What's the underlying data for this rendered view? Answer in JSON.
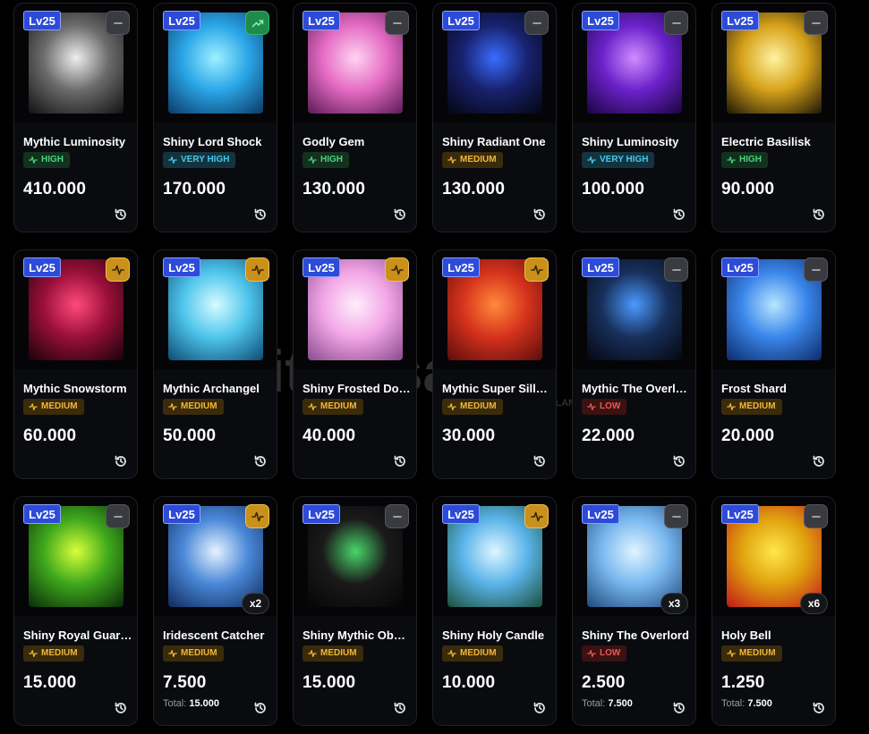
{
  "level_label": "Lv25",
  "total_label": "Total:",
  "watermark": "itemsatis",
  "watermark_sub": "HESAP / SKIN / İLAN",
  "cards": [
    {
      "name": "Mythic Luminosity",
      "demand": "HIGH",
      "demand_style": "high",
      "price": "410.000",
      "trend": "flat",
      "art": [
        "#eeeeee",
        "#6b6b6b",
        "#111"
      ]
    },
    {
      "name": "Shiny Lord Shock",
      "demand": "VERY HIGH",
      "demand_style": "vhigh",
      "price": "170.000",
      "trend": "up",
      "art": [
        "#9ff0ff",
        "#2aa6e8",
        "#0b3a66"
      ]
    },
    {
      "name": "Godly Gem",
      "demand": "HIGH",
      "demand_style": "high",
      "price": "130.000",
      "trend": "flat",
      "art": [
        "#ffd3f2",
        "#e56cc4",
        "#5a1a55"
      ]
    },
    {
      "name": "Shiny Radiant One",
      "demand": "MEDIUM",
      "demand_style": "med",
      "price": "130.000",
      "trend": "flat",
      "art": [
        "#3a6cff",
        "#18226e",
        "#04050f"
      ]
    },
    {
      "name": "Shiny Luminosity",
      "demand": "VERY HIGH",
      "demand_style": "vhigh",
      "price": "100.000",
      "trend": "flat",
      "art": [
        "#d08cff",
        "#6a22c9",
        "#1a0440"
      ]
    },
    {
      "name": "Electric Basilisk",
      "demand": "HIGH",
      "demand_style": "high",
      "price": "90.000",
      "trend": "flat",
      "art": [
        "#fff3a0",
        "#d6a21a",
        "#1e1606"
      ]
    },
    {
      "name": "Mythic Snowstorm",
      "demand": "MEDIUM",
      "demand_style": "med",
      "price": "60.000",
      "trend": "warn",
      "art": [
        "#ff4a7a",
        "#9a0f3a",
        "#1a0208"
      ]
    },
    {
      "name": "Mythic Archangel",
      "demand": "MEDIUM",
      "demand_style": "med",
      "price": "50.000",
      "trend": "warn",
      "art": [
        "#d6fbff",
        "#4fc6ec",
        "#0d4a73"
      ]
    },
    {
      "name": "Shiny Frosted Dog...",
      "demand": "MEDIUM",
      "demand_style": "med",
      "price": "40.000",
      "trend": "warn",
      "art": [
        "#ffeefc",
        "#f2a6e6",
        "#8a4a8f"
      ]
    },
    {
      "name": "Mythic Super Silly ...",
      "demand": "MEDIUM",
      "demand_style": "med",
      "price": "30.000",
      "trend": "warn",
      "art": [
        "#ff8a3a",
        "#d6321c",
        "#5a0d0d"
      ]
    },
    {
      "name": "Mythic The Overlord",
      "demand": "LOW",
      "demand_style": "low",
      "price": "22.000",
      "trend": "flat",
      "art": [
        "#4a9bff",
        "#18305c",
        "#05070f"
      ]
    },
    {
      "name": "Frost Shard",
      "demand": "MEDIUM",
      "demand_style": "med",
      "price": "20.000",
      "trend": "flat",
      "art": [
        "#b8e6ff",
        "#3a86ea",
        "#0c2a6a"
      ]
    },
    {
      "name": "Shiny Royal Guardi...",
      "demand": "MEDIUM",
      "demand_style": "med",
      "price": "15.000",
      "trend": "flat",
      "art": [
        "#d8ff3a",
        "#3ea81c",
        "#0a2a0a"
      ]
    },
    {
      "name": "Iridescent Catcher",
      "demand": "MEDIUM",
      "demand_style": "med",
      "price": "7.500",
      "trend": "warn",
      "qty": "x2",
      "total": "15.000",
      "art": [
        "#e6f3ff",
        "#4a88d8",
        "#0f2a5a"
      ]
    },
    {
      "name": "Shiny Mythic Obsc...",
      "demand": "MEDIUM",
      "demand_style": "med",
      "price": "15.000",
      "trend": "flat",
      "art": [
        "#4ad66a",
        "#1a1a1a",
        "#050505"
      ]
    },
    {
      "name": "Shiny Holy Candle",
      "demand": "MEDIUM",
      "demand_style": "med",
      "price": "10.000",
      "trend": "warn",
      "art": [
        "#dff6ff",
        "#5ab4ea",
        "#1a4f3a"
      ]
    },
    {
      "name": "Shiny The Overlord",
      "demand": "LOW",
      "demand_style": "low",
      "price": "2.500",
      "trend": "flat",
      "qty": "x3",
      "total": "7.500",
      "art": [
        "#e0f4ff",
        "#7ab8f0",
        "#1e4a7a"
      ]
    },
    {
      "name": "Holy Bell",
      "demand": "MEDIUM",
      "demand_style": "med",
      "price": "1.250",
      "trend": "flat",
      "qty": "x6",
      "total": "7.500",
      "art": [
        "#ffe84a",
        "#e0a20e",
        "#c21818"
      ]
    }
  ]
}
